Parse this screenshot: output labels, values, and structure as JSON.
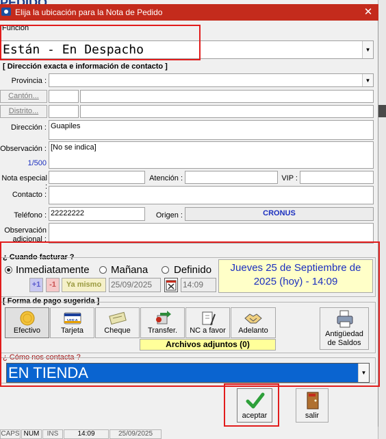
{
  "background": {
    "app_title": "PEDIDO",
    "status_bar": [
      "CAPS",
      "NUM",
      "INS",
      "14:09",
      "25/09/2025"
    ]
  },
  "dialog": {
    "title": "Elija la ubicación para la Nota de Pedido",
    "close_label": "✕",
    "funcion_label": "Función",
    "funcion_value": "Están - En Despacho",
    "address_section_title": "[ Dirección exacta e información de contacto ]",
    "provincia_label": "Provincia :",
    "provincia_value": "",
    "canton_button": "Cantón...",
    "distrito_button": "Distrito...",
    "direccion_label": "Dirección :",
    "direccion_value": "Guapiles",
    "observacion_label": "Observación :",
    "observacion_value": "[No se indica]",
    "observacion_counter": "1/500",
    "nota_especial_label": "Nota especial :",
    "atencion_label": "Atención :",
    "vip_label": "VIP :",
    "contacto_label": "Contacto :",
    "telefono_label": "Teléfono :",
    "telefono_value": "22222222",
    "origen_label": "Origen :",
    "origen_value": "CRONUS",
    "obs_adicional_label_1": "Observación",
    "obs_adicional_label_2": "adicional :"
  },
  "when": {
    "title": "¿ Cuando facturar ?",
    "options": [
      "Inmediatamente",
      "Mañana",
      "Definido"
    ],
    "selected": "Inmediatamente",
    "plus_label": "+1",
    "minus_label": "-1",
    "ya_mismo_label": "Ya mismo",
    "date_value": "25/09/2025",
    "time_value": "14:09",
    "summary_line1": "Jueves 25 de Septiembre de",
    "summary_line2": "2025 (hoy) - 14:09"
  },
  "payment": {
    "title": "[ Forma de pago sugerida ]",
    "methods": [
      "Efectivo",
      "Tarjeta",
      "Cheque",
      "Transfer.",
      "NC a favor",
      "Adelanto"
    ],
    "attachments_label": "Archivos adjuntos (0)",
    "antiguedad_line1": "Antigüedad",
    "antiguedad_line2": "de Saldos"
  },
  "contact": {
    "title": "¿ Cómo nos contacta ?",
    "value": "EN TIENDA"
  },
  "actions": {
    "accept_label": "aceptar",
    "exit_label": "salir"
  },
  "colors": {
    "titlebar": "#c42b1c",
    "highlight_border": "#e21c1c",
    "summary_bg": "#ffffc8",
    "summary_text": "#1b2fbf",
    "contact_bg": "#0a64d0",
    "origen_text": "#1b2fbf",
    "attachments_bg": "#ffff9a"
  }
}
